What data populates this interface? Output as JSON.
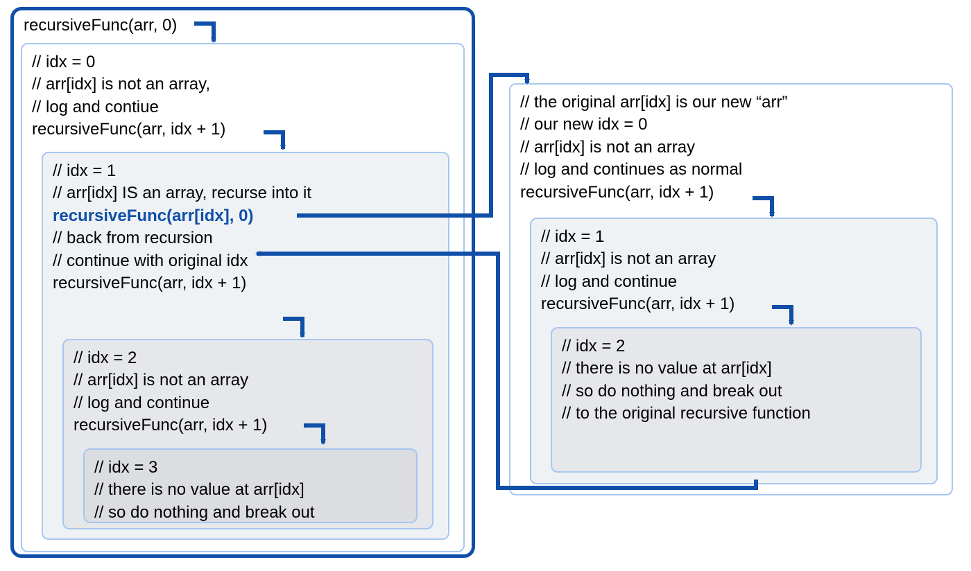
{
  "colors": {
    "blue_dark": "#0f4fa8",
    "blue_light": "#a7c7f0",
    "gray1": "#eff2f5",
    "gray2": "#e5e7ea",
    "gray3": "#dbdde0"
  },
  "left": {
    "title": "recursiveFunc(arr, 0)",
    "lvl0": {
      "l1": "// idx = 0",
      "l2": "// arr[idx] is not an array,",
      "l3": "// log and contiue",
      "l4": "recursiveFunc(arr, idx + 1)"
    },
    "lvl1": {
      "l1": "// idx = 1",
      "l2": "// arr[idx] IS an array, recurse into it",
      "l3": "recursiveFunc(arr[idx], 0)",
      "l4": "// back from recursion",
      "l5": "// continue with original idx",
      "l6": "recursiveFunc(arr, idx + 1)"
    },
    "lvl2": {
      "l1": "// idx = 2",
      "l2": "// arr[idx] is not an array",
      "l3": "// log and continue",
      "l4": "recursiveFunc(arr, idx + 1)"
    },
    "lvl3": {
      "l1": "// idx = 3",
      "l2": "// there is no value at arr[idx]",
      "l3": "// so do nothing and break out"
    }
  },
  "right": {
    "lvl0": {
      "l1": "// the original arr[idx] is our new “arr”",
      "l2": "// our new idx = 0",
      "l3": "// arr[idx] is not an array",
      "l4": "// log and continues as normal",
      "l5": "recursiveFunc(arr, idx + 1)"
    },
    "lvl1": {
      "l1": "// idx = 1",
      "l2": "// arr[idx] is not an array",
      "l3": "// log and continue",
      "l4": "recursiveFunc(arr, idx + 1)"
    },
    "lvl2": {
      "l1": "// idx = 2",
      "l2": "// there is no value at arr[idx]",
      "l3": "// so do nothing and break out",
      "l4": "// to the original recursive function"
    }
  }
}
